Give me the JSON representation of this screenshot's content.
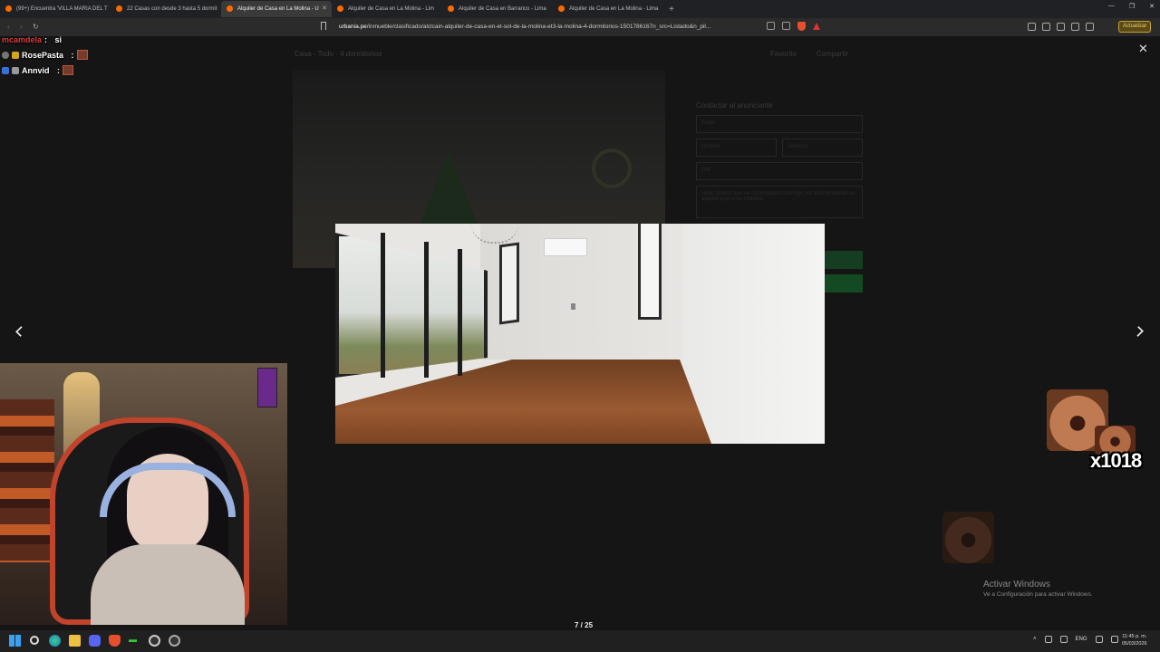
{
  "browser": {
    "tabs": [
      {
        "label": "(99+) Encuentra 'VILLA MARIA DEL T",
        "active": false
      },
      {
        "label": "22 Casas con desde 3 hasta 5 dormit",
        "active": false
      },
      {
        "label": "Alquiler de Casa en La Molina - U",
        "active": true
      },
      {
        "label": "Alquiler de Casa en La Molina - Lim",
        "active": false
      },
      {
        "label": "Alquiler de Casa en Barranco - Lima",
        "active": false
      },
      {
        "label": "Alquiler de Casa en La Molina - Lima",
        "active": false
      }
    ],
    "url_domain": "urbania.pe",
    "url_path": "/inmueble/clasificado/alclcain-alquiler-de-casa-en-el-sol-de-la-molina-et3-la-molina-4-dormitorios-1501786167n_src=Listado&n_pil...",
    "update_label": "Actualizar"
  },
  "chat": [
    {
      "name": "mcamdela",
      "message": "si",
      "color": "#e03a3a"
    },
    {
      "name": "RosePasta",
      "message": ":",
      "color": "#ffffff"
    },
    {
      "name": "Annvid",
      "message": ":",
      "color": "#ffffff"
    }
  ],
  "page": {
    "title": "Casa · Todo · 4 dormitorios",
    "links": [
      "Favorito",
      "Compartir"
    ],
    "contact_title": "Contactar al anunciante",
    "placeholders": [
      "Email",
      "Nombre",
      "Teléfono",
      "DNI",
      "Hola! Quiero que se comuniquen conmigo por este inmueble en alquiler que vi en Urbania."
    ]
  },
  "gallery": {
    "counter": "7 / 25",
    "close_icon": "close-icon",
    "prev_icon": "chevron-left-icon",
    "next_icon": "chevron-right-icon"
  },
  "overlay": {
    "combo": "x1018"
  },
  "windows_activation": {
    "title": "Activar Windows",
    "subtitle": "Ve a Configuración para activar Windows."
  },
  "taskbar": {
    "lang": "ENG",
    "time": "11:45 p. m.",
    "date": "05/03/2026"
  },
  "colors": {
    "accent_green": "#1b7a3a",
    "update_gold": "#c9a232"
  }
}
